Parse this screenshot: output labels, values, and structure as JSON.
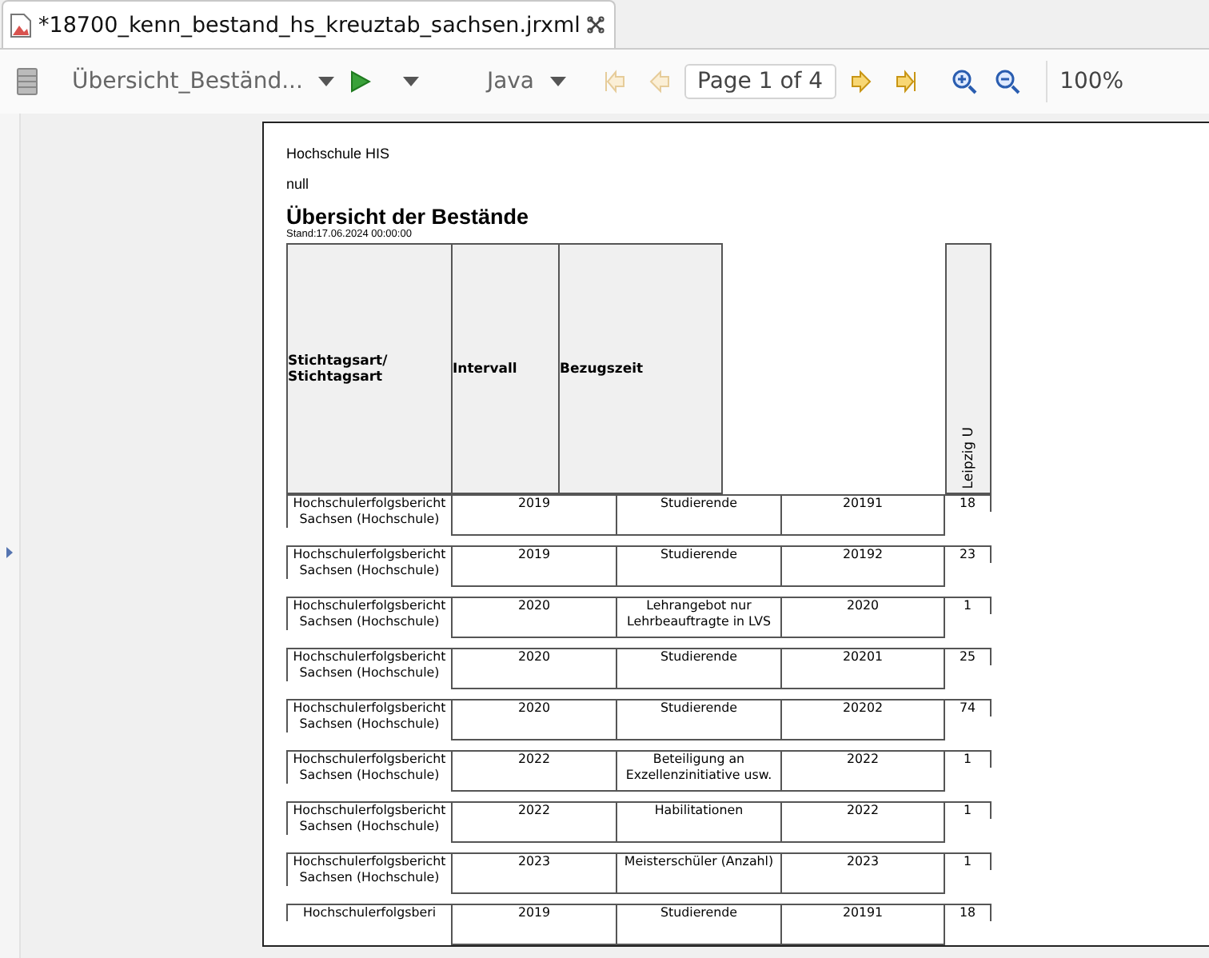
{
  "tab": {
    "title": "*18700_kenn_bestand_hs_kreuztab_sachsen.jrxml"
  },
  "toolbar": {
    "dataset": "Übersicht_Beständ...",
    "language": "Java",
    "page": "Page 1 of 4",
    "zoom": "100%",
    "nav": [
      {
        "kind": "first",
        "disabled": true
      },
      {
        "kind": "prev",
        "disabled": true
      },
      {
        "kind": "next",
        "disabled": false
      },
      {
        "kind": "last",
        "disabled": false
      }
    ]
  },
  "report": {
    "institution": "Hochschule HIS",
    "subtitle": "null",
    "title": "Übersicht der Bestände",
    "stand": "Stand:17.06.2024 00:00:00",
    "headers": [
      "Stichtagsart/ Stichtagsart",
      "Intervall",
      "Bezugszeit"
    ],
    "column_header": "Leipzig U",
    "rows": [
      {
        "cells": [
          "Hochschulerfolgsbericht Sachsen (Hochschule)",
          "2019",
          "Studierende",
          "20191"
        ],
        "value": "18"
      },
      {
        "cells": [
          "Hochschulerfolgsbericht Sachsen (Hochschule)",
          "2019",
          "Studierende",
          "20192"
        ],
        "value": "23"
      },
      {
        "cells": [
          "Hochschulerfolgsbericht Sachsen (Hochschule)",
          "2020",
          "Lehrangebot nur Lehrbeauftragte in LVS",
          "2020"
        ],
        "value": "1"
      },
      {
        "cells": [
          "Hochschulerfolgsbericht Sachsen (Hochschule)",
          "2020",
          "Studierende",
          "20201"
        ],
        "value": "25"
      },
      {
        "cells": [
          "Hochschulerfolgsbericht Sachsen (Hochschule)",
          "2020",
          "Studierende",
          "20202"
        ],
        "value": "74"
      },
      {
        "cells": [
          "Hochschulerfolgsbericht Sachsen (Hochschule)",
          "2022",
          "Beteiligung an Exzellenzinitiative usw.",
          "2022"
        ],
        "value": "1"
      },
      {
        "cells": [
          "Hochschulerfolgsbericht Sachsen (Hochschule)",
          "2022",
          "Habilitationen",
          "2022"
        ],
        "value": "1"
      },
      {
        "cells": [
          "Hochschulerfolgsbericht Sachsen (Hochschule)",
          "2023",
          "Meisterschüler (Anzahl)",
          "2023"
        ],
        "value": "1"
      },
      {
        "cells": [
          "Hochschulerfolgsberi",
          "2019",
          "Studierende",
          "20191"
        ],
        "value": "18"
      }
    ]
  }
}
